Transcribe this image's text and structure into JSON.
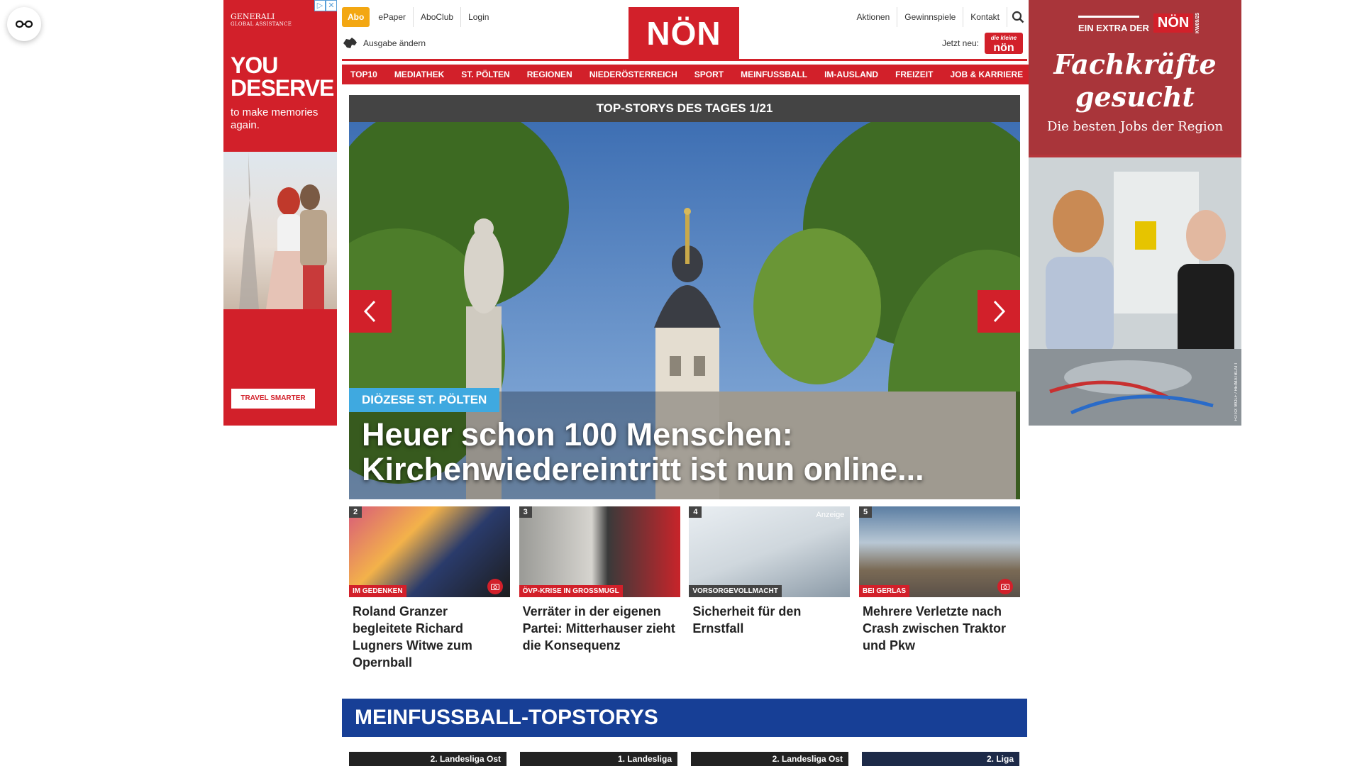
{
  "float_button": {
    "icon": "glasses-icon"
  },
  "ad_left": {
    "brand": "GENERALI",
    "brand_sub": "GLOBAL ASSISTANCE",
    "headline_1": "YOU",
    "headline_2": "DESERVE",
    "sub": "to make memories again.",
    "cta": "TRAVEL SMARTER"
  },
  "ad_right": {
    "extra_label": "EIN EXTRA DER",
    "extra_logo": "NÖN",
    "extra_year": "KW09/25",
    "title_1": "Fachkräfte",
    "title_2": "gesucht",
    "claim": "Die besten Jobs der Region",
    "credit": "FOTO: WOLF / HEIMATBLATT"
  },
  "header": {
    "abo": "Abo",
    "links_left": [
      "ePaper",
      "AboClub",
      "Login"
    ],
    "ausgabe": "Ausgabe ändern",
    "logo": "NÖN",
    "links_right": [
      "Aktionen",
      "Gewinnspiele",
      "Kontakt"
    ],
    "jetzt": "Jetzt neu:",
    "jetzt_badge_top": "die kleine",
    "jetzt_badge": "nön"
  },
  "nav": [
    "TOP10",
    "MEDIATHEK",
    "ST. PÖLTEN",
    "REGIONEN",
    "NIEDERÖSTERREICH",
    "SPORT",
    "MEINFUSSBALL",
    "IM-AUSLAND",
    "FREIZEIT",
    "JOB & KARRIERE"
  ],
  "hero": {
    "title": "TOP-STORYS DES TAGES 1/21",
    "kicker": "DIÖZESE ST. PÖLTEN",
    "headline": "Heuer schon 100 Menschen: Kirchenwiedereintritt ist nun online..."
  },
  "cards": [
    {
      "num": "2",
      "tag": "IM GEDENKEN",
      "title": "Roland Granzer begleitete Richard Lugners Witwe zum Opernball"
    },
    {
      "num": "3",
      "tag": "ÖVP-KRISE IN GROSSMUGL",
      "title": "Verräter in der eigenen Partei: Mitterhauser zieht die Konsequenz"
    },
    {
      "num": "4",
      "tag": "VORSORGEVOLLMACHT",
      "title": "Sicherheit für den Ernstfall",
      "badge": "Anzeige"
    },
    {
      "num": "5",
      "tag": "BEI GERLAS",
      "title": "Mehrere Verletzte nach Crash zwischen Traktor und Pkw"
    }
  ],
  "section": {
    "title": "MEINFUSSBALL-TOPSTORYS",
    "items": [
      "2. Landesliga Ost",
      "1. Landesliga",
      "2. Landesliga Ost",
      "2. Liga"
    ]
  }
}
